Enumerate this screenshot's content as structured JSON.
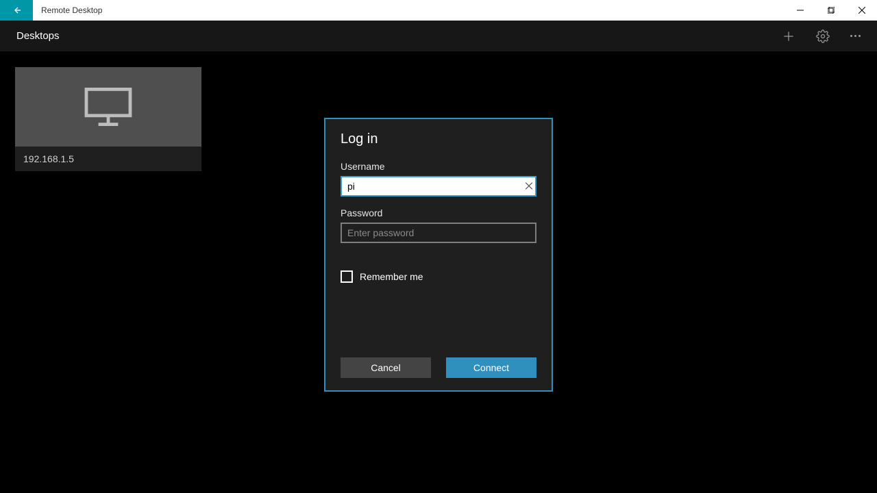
{
  "titlebar": {
    "app_name": "Remote Desktop"
  },
  "header": {
    "title": "Desktops"
  },
  "tiles": [
    {
      "label": "192.168.1.5"
    }
  ],
  "dialog": {
    "title": "Log in",
    "username_label": "Username",
    "username_value": "pi",
    "password_label": "Password",
    "password_placeholder": "Enter password",
    "password_value": "",
    "remember_label": "Remember me",
    "remember_checked": false,
    "cancel_label": "Cancel",
    "connect_label": "Connect"
  },
  "colors": {
    "accent": "#2f8fbd",
    "back_button": "#0097a7"
  }
}
